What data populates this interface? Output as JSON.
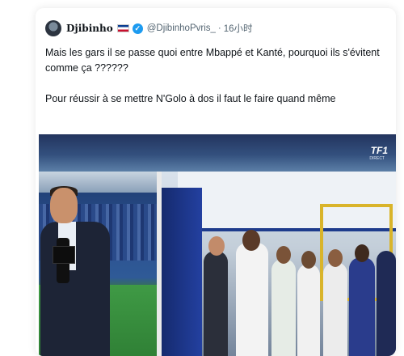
{
  "tweet": {
    "display_name": "Djibinho",
    "handle": "@DjibinhoPvris_",
    "separator": "·",
    "time": "16小时",
    "text_lines": [
      "Mais les gars il se passe quoi entre Mbappé et Kanté, pourquoi ils s'évitent comme ça ??????",
      "Pour réussir à se mettre N'Golo à dos il faut le faire quand même"
    ]
  },
  "media": {
    "channel_logo": "TF1",
    "channel_sub": "DIRECT"
  },
  "icons": {
    "avatar": "avatar-icon",
    "flag": "costa-rica-flag-icon",
    "verified": "verified-badge-icon"
  },
  "colors": {
    "verified": "#1d9bf0",
    "text": "#0f1419",
    "secondary": "#536471"
  }
}
